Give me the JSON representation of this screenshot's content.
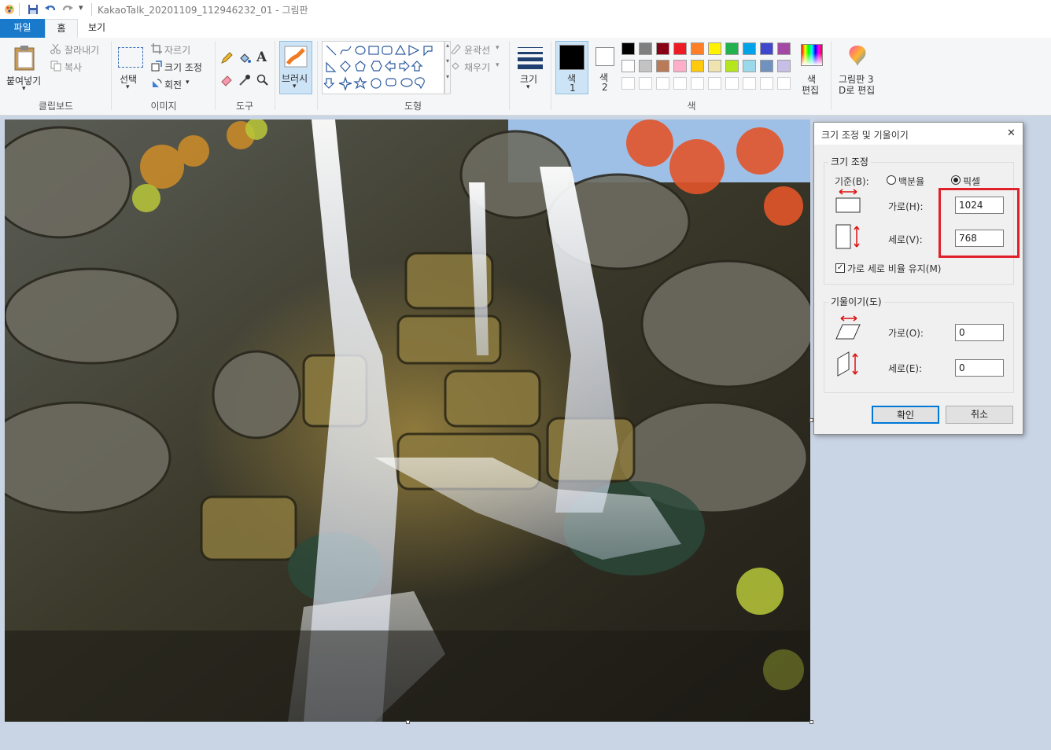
{
  "window": {
    "title": "KakaoTalk_20201109_112946232_01 - 그림판",
    "quick_access_dropdown": "▾"
  },
  "tabs": [
    {
      "label": "파일"
    },
    {
      "label": "홈"
    },
    {
      "label": "보기"
    }
  ],
  "ribbon": {
    "clipboard": {
      "paste_label": "붙여넣기",
      "cut_label": "잘라내기",
      "copy_label": "복사",
      "group_label": "클립보드"
    },
    "image": {
      "select_label": "선택",
      "crop_label": "자르기",
      "resize_label": "크기 조정",
      "rotate_label": "회전",
      "group_label": "이미지"
    },
    "tools": {
      "group_label": "도구",
      "text_glyph": "A"
    },
    "brush": {
      "label": "브러시"
    },
    "shapes": {
      "outline_label": "윤곽선",
      "fill_label": "채우기",
      "group_label": "도형"
    },
    "size": {
      "label": "크기"
    },
    "colors": {
      "color1_label": "색",
      "color1_num": "1",
      "color2_label": "색",
      "color2_num": "2",
      "edit_colors_label_1": "색",
      "edit_colors_label_2": "편집",
      "group_label": "색",
      "color1_value": "#000000",
      "color2_value": "#ffffff",
      "palette_row1": [
        "#000000",
        "#7f7f7f",
        "#880015",
        "#ed1c24",
        "#ff7f27",
        "#fff200",
        "#22b14c",
        "#00a2e8",
        "#3f48cc",
        "#a349a4"
      ],
      "palette_row2": [
        "#ffffff",
        "#c3c3c3",
        "#b97a57",
        "#ffaec9",
        "#ffc90e",
        "#efe4b0",
        "#b5e61d",
        "#99d9ea",
        "#7092be",
        "#c8bfe7"
      ]
    },
    "paint3d": {
      "label_1": "그림판 3",
      "label_2": "D로 편집"
    }
  },
  "dialog": {
    "title": "크기 조정 및 기울이기",
    "close_glyph": "✕",
    "resize": {
      "legend": "크기 조정",
      "basis_label": "기준(B):",
      "percent_label": "백분율",
      "pixel_label": "픽셀",
      "selected_basis": "픽셀",
      "horizontal_label": "가로(H):",
      "horizontal_value": "1024",
      "vertical_label": "세로(V):",
      "vertical_value": "768",
      "keep_ratio_label": "가로 세로 비율 유지(M)",
      "keep_ratio_checked": true
    },
    "skew": {
      "legend": "기울이기(도)",
      "horizontal_label": "가로(O):",
      "horizontal_value": "0",
      "vertical_label": "세로(E):",
      "vertical_value": "0"
    },
    "ok_label": "확인",
    "cancel_label": "취소",
    "highlight_color": "#e0202a"
  }
}
